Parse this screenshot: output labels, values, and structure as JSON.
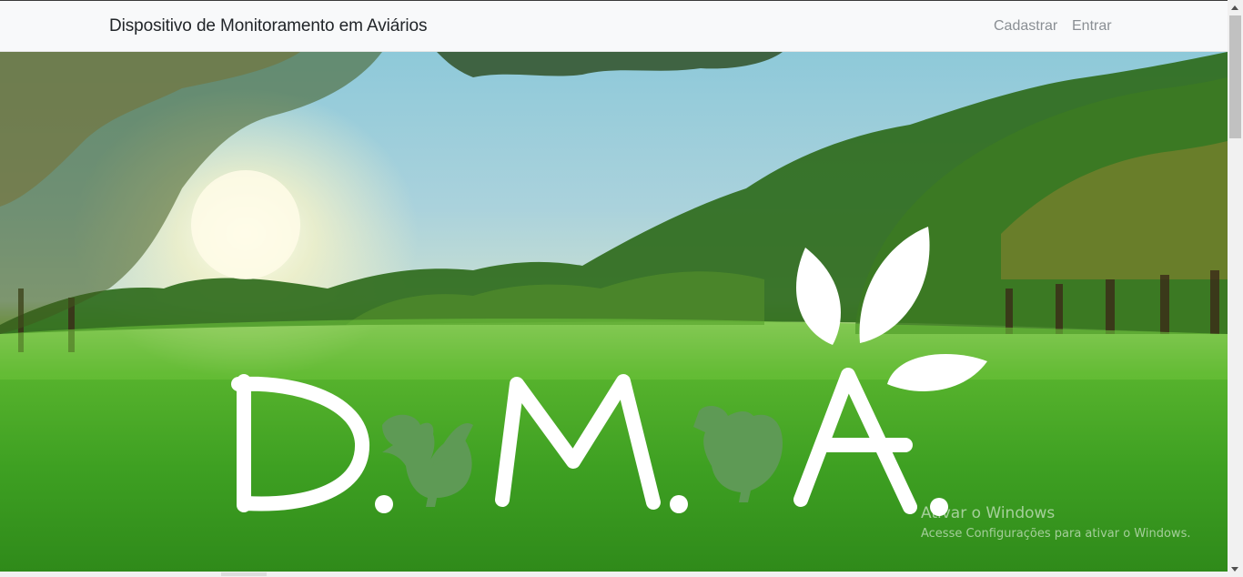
{
  "navbar": {
    "brand": "Dispositivo de Monitoramento em Aviários",
    "links": [
      "Cadastrar",
      "Entrar"
    ]
  },
  "hero": {
    "logo_text": "D.M.A."
  },
  "watermark": {
    "title": "Ativar o Windows",
    "subtitle": "Acesse Configurações para ativar o Windows."
  },
  "colors": {
    "navbar_bg": "#f8f9fa",
    "brand_text": "#212529",
    "link_text": "#8a8f94",
    "logo_white": "#ffffff",
    "chicken_green": "#5e9a55"
  }
}
